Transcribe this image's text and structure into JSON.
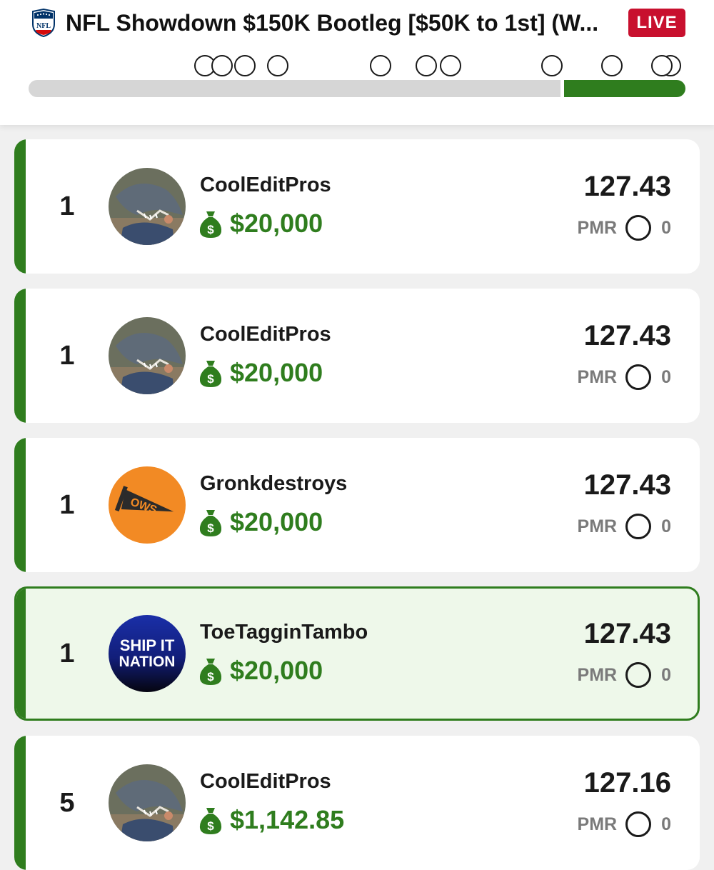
{
  "header": {
    "league_icon": "nfl-shield-icon",
    "title": "NFL Showdown $150K Bootleg [$50K to 1st] (W...",
    "live_badge": "LIVE"
  },
  "progress": {
    "completed_fraction": 0.81
  },
  "entries": [
    {
      "rank": "1",
      "username": "CoolEditPros",
      "winnings": "$20,000",
      "score": "127.43",
      "pmr_label": "PMR",
      "pmr_value": "0",
      "avatar": "shark-photo",
      "highlighted": false
    },
    {
      "rank": "1",
      "username": "CoolEditPros",
      "winnings": "$20,000",
      "score": "127.43",
      "pmr_label": "PMR",
      "pmr_value": "0",
      "avatar": "shark-photo",
      "highlighted": false
    },
    {
      "rank": "1",
      "username": "Gronkdestroys",
      "winnings": "$20,000",
      "score": "127.43",
      "pmr_label": "PMR",
      "pmr_value": "0",
      "avatar": "pennant-logo",
      "avatar_text": "OWS",
      "highlighted": false
    },
    {
      "rank": "1",
      "username": "ToeTagginTambo",
      "winnings": "$20,000",
      "score": "127.43",
      "pmr_label": "PMR",
      "pmr_value": "0",
      "avatar": "ship-it-nation-logo",
      "avatar_text_1": "SHIP IT",
      "avatar_text_2": "NATION",
      "highlighted": true
    },
    {
      "rank": "5",
      "username": "CoolEditPros",
      "winnings": "$1,142.85",
      "score": "127.16",
      "pmr_label": "PMR",
      "pmr_value": "0",
      "avatar": "shark-photo",
      "highlighted": false
    }
  ],
  "colors": {
    "accent_green": "#2f7d1e",
    "live_red": "#c8102e",
    "highlight_bg": "#eef8ea"
  }
}
